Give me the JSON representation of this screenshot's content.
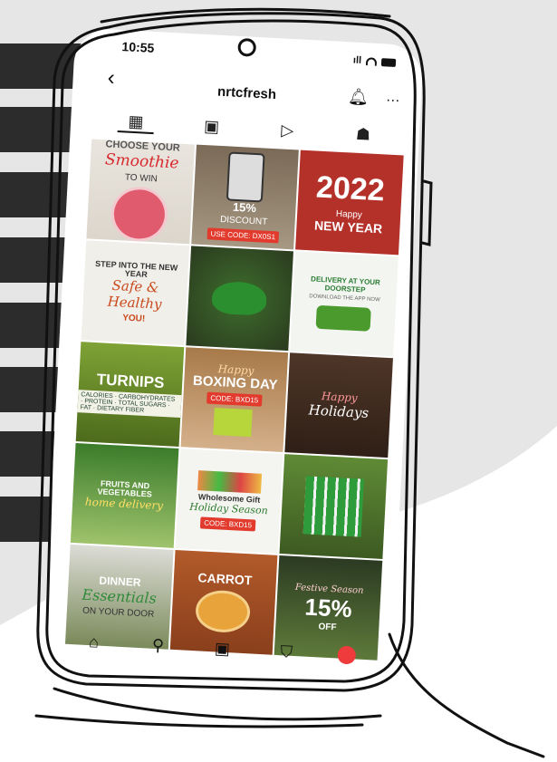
{
  "status_bar": {
    "time": "10:55"
  },
  "profile": {
    "username": "nrtcfresh"
  },
  "icons": {
    "back": "‹",
    "bell": "♪",
    "more": "…",
    "grid_tab": "▦",
    "reels_tab": "▣",
    "play_tab": "▷",
    "tagged_tab": "☗",
    "home": "⌂",
    "search": "⚲",
    "reels": "▣",
    "shop": "⛉"
  },
  "tiles": {
    "t1": {
      "line1": "CHOOSE YOUR",
      "line2": "Smoothie",
      "line3": "TO WIN"
    },
    "t2": {
      "line1": "15%",
      "line2": "DISCOUNT",
      "line3": "USE CODE: DX0S1"
    },
    "t3": {
      "line1": "2022",
      "line2": "Happy",
      "line3": "NEW YEAR"
    },
    "t4": {
      "line1": "STEP INTO THE NEW YEAR",
      "line2": "Safe & Healthy",
      "line3": "YOU!"
    },
    "t5": {
      "line1": ""
    },
    "t6": {
      "line1": "DELIVERY AT YOUR DOORSTEP",
      "line2": "DOWNLOAD THE APP NOW"
    },
    "t7": {
      "line1": "TURNIPS",
      "rows": "CALORIES · CARBOHYDRATES · PROTEIN · TOTAL SUGARS · FAT · DIETARY FIBER"
    },
    "t8": {
      "line1": "Happy",
      "line2": "BOXING DAY",
      "line3": "CODE: BXD15"
    },
    "t9": {
      "line1": "Happy",
      "line2": "Holidays"
    },
    "t10": {
      "line1": "FRUITS AND VEGETABLES",
      "line2": "home delivery"
    },
    "t11": {
      "line1": "Wholesome Gift",
      "line2": "Holiday Season",
      "line3": "CODE: BXD15"
    },
    "t12": {
      "line1": ""
    },
    "t13": {
      "line1": "DINNER",
      "line2": "Essentials",
      "line3": "ON YOUR DOOR"
    },
    "t14": {
      "line1": "CARROT"
    },
    "t15": {
      "line1": "Festive Season",
      "line2": "15%",
      "line3": "OFF"
    }
  },
  "colors": {
    "stripes": "#2c2c2c",
    "background_shape": "#e6e6e6",
    "profile_avatar": "#ef3b3b"
  }
}
